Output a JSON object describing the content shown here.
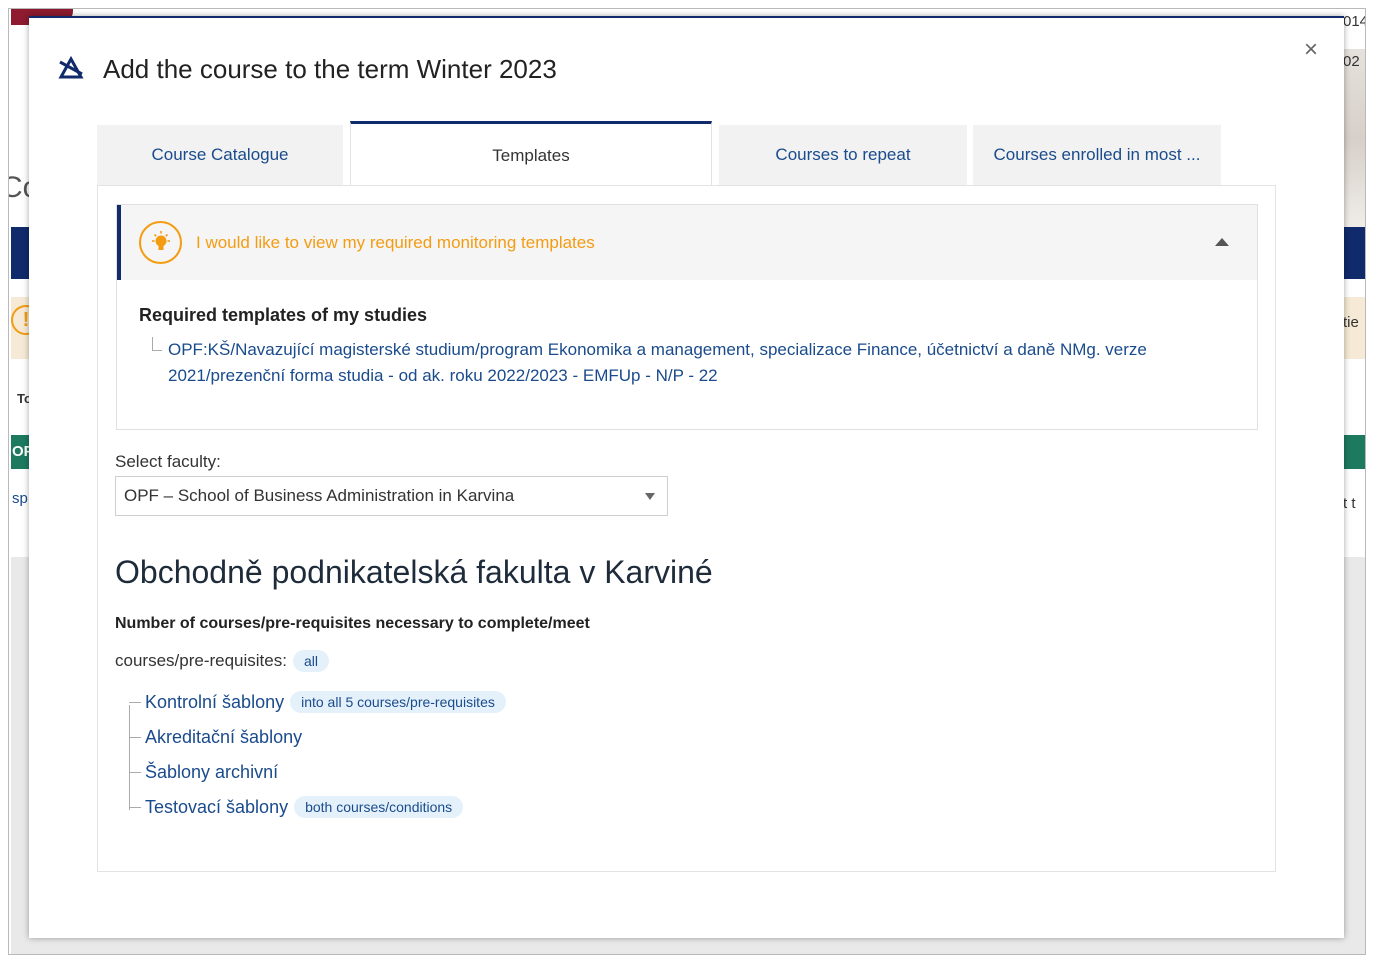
{
  "background": {
    "frag_top_right_1": "014",
    "frag_top_right_2": "02",
    "frag_left_co": "Co",
    "frag_left_to": "To",
    "frag_left_op": "OP",
    "frag_left_sp": "sp",
    "frag_right_tie": "tie",
    "frag_right_tt": "t t",
    "warn_glyph": "!"
  },
  "modal": {
    "title": "Add the course to the term Winter 2023",
    "close_glyph": "×",
    "tabs": [
      {
        "label": "Course Catalogue"
      },
      {
        "label": "Templates"
      },
      {
        "label": "Courses to repeat"
      },
      {
        "label": "Courses enrolled in most ..."
      }
    ],
    "active_tab": "Templates",
    "accordion": {
      "title": "I would like to view my required monitoring templates",
      "required_heading": "Required templates of my studies",
      "required_link": "OPF:KŠ/Navazující magisterské studium/program Ekonomika a management, specializace Finance, účetnictví a daně NMg. verze 2021/prezenční forma studia - od ak. roku 2022/2023 - EMFUp - N/P - 22"
    },
    "faculty": {
      "label": "Select faculty:",
      "selected": "OPF – School of Business Administration in Karvina"
    },
    "faculty_name": "Obchodně podnikatelská fakulta v Karviné",
    "requirements_heading": "Number of courses/pre-requisites necessary to complete/meet",
    "courses_label": "courses/pre-requisites:",
    "courses_badge": "all",
    "tree": [
      {
        "label": "Kontrolní šablony",
        "badge": "into all 5 courses/pre-requisites"
      },
      {
        "label": "Akreditační šablony",
        "badge": ""
      },
      {
        "label": "Šablony archivní",
        "badge": ""
      },
      {
        "label": "Testovací šablony",
        "badge": "both courses/conditions"
      }
    ]
  },
  "colors": {
    "navy": "#102a6b",
    "link": "#1a4b8c",
    "orange": "#f39c12",
    "badge_bg": "#e4f1fa"
  }
}
